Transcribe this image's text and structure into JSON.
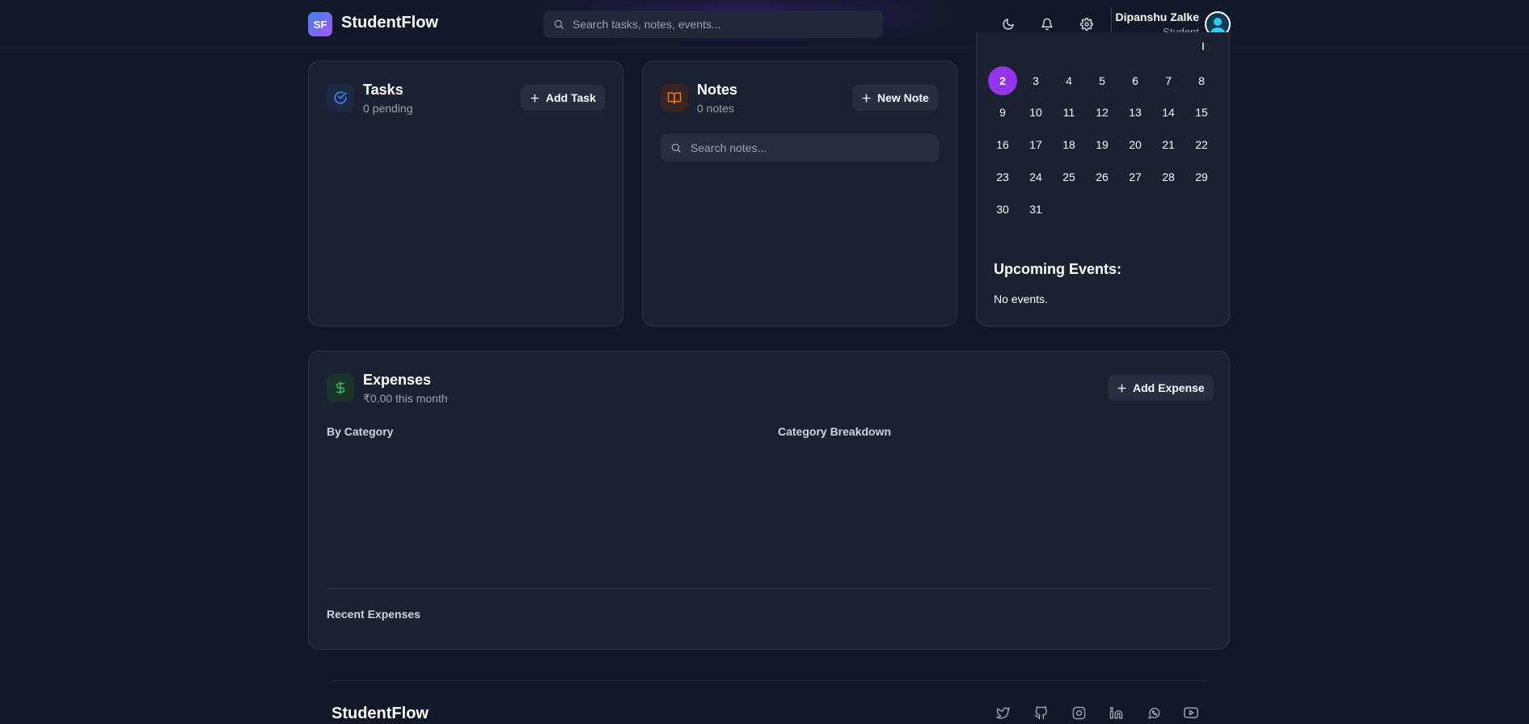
{
  "header": {
    "logo_initials": "SF",
    "app_name": "StudentFlow",
    "search_placeholder": "Search tasks, notes, events...",
    "user": {
      "name": "Dipanshu Zalke",
      "role": "Student"
    }
  },
  "tasks": {
    "title": "Tasks",
    "subtitle": "0 pending",
    "add_label": "Add Task"
  },
  "notes": {
    "title": "Notes",
    "subtitle": "0 notes",
    "add_label": "New Note",
    "search_placeholder": "Search notes..."
  },
  "calendar": {
    "partial_top_glyph": "I",
    "selected_day": "2",
    "days": [
      "2",
      "3",
      "4",
      "5",
      "6",
      "7",
      "8",
      "9",
      "10",
      "11",
      "12",
      "13",
      "14",
      "15",
      "16",
      "17",
      "18",
      "19",
      "20",
      "21",
      "22",
      "23",
      "24",
      "25",
      "26",
      "27",
      "28",
      "29",
      "30",
      "31"
    ],
    "upcoming_title": "Upcoming Events:",
    "no_events": "No events."
  },
  "expenses": {
    "title": "Expenses",
    "subtitle": "₹0.00 this month",
    "add_label": "Add Expense",
    "by_category": "By Category",
    "category_breakdown": "Category Breakdown",
    "recent": "Recent Expenses"
  },
  "footer": {
    "brand": "StudentFlow",
    "social_icons": [
      "twitter-icon",
      "github-icon",
      "instagram-icon",
      "linkedin-icon",
      "whatsapp-icon",
      "youtube-icon"
    ]
  },
  "colors": {
    "background": "#111827",
    "card": "#1a2232",
    "accent_purple": "#9333ea",
    "tasks_icon": "#3b82f6",
    "notes_icon": "#f97316",
    "expenses_icon": "#22c55e"
  }
}
